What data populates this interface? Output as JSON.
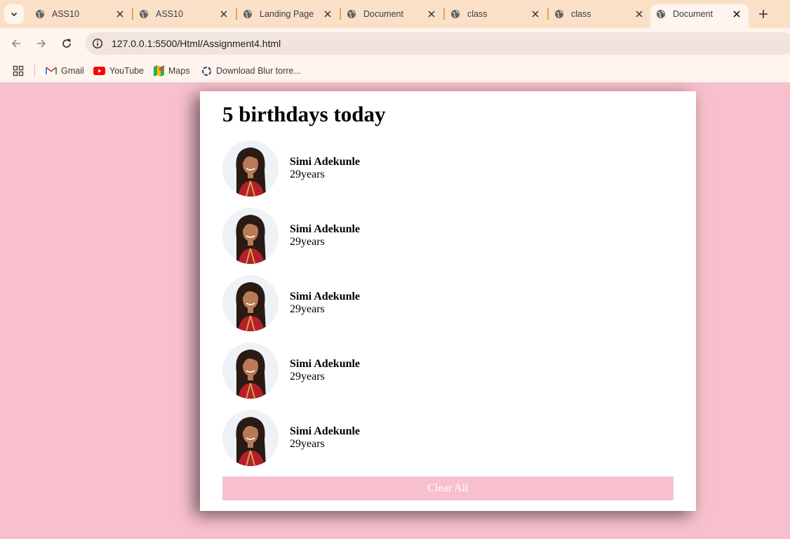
{
  "browser": {
    "tabs": [
      {
        "title": "ASS10",
        "active": false
      },
      {
        "title": "ASS10",
        "active": false
      },
      {
        "title": "Landing Page",
        "active": false
      },
      {
        "title": "Document",
        "active": false
      },
      {
        "title": "class",
        "active": false
      },
      {
        "title": "class",
        "active": false
      },
      {
        "title": "Document",
        "active": true
      }
    ],
    "url": "127.0.0.1:5500/Html/Assignment4.html",
    "bookmarks": [
      {
        "label": "Gmail",
        "icon": "gmail-icon"
      },
      {
        "label": "YouTube",
        "icon": "youtube-icon"
      },
      {
        "label": "Maps",
        "icon": "maps-icon"
      },
      {
        "label": "Download Blur torre...",
        "icon": "blur-icon"
      }
    ]
  },
  "page": {
    "heading": "5 birthdays today",
    "people": [
      {
        "name": "Simi Adekunle",
        "age": "29years"
      },
      {
        "name": "Simi Adekunle",
        "age": "29years"
      },
      {
        "name": "Simi Adekunle",
        "age": "29years"
      },
      {
        "name": "Simi Adekunle",
        "age": "29years"
      },
      {
        "name": "Simi Adekunle",
        "age": "29years"
      }
    ],
    "clear_label": "Clear All"
  },
  "colors": {
    "page_background": "#f8c0cc",
    "button_background": "#f8c0cc",
    "tab_strip": "#fbe0c8"
  }
}
